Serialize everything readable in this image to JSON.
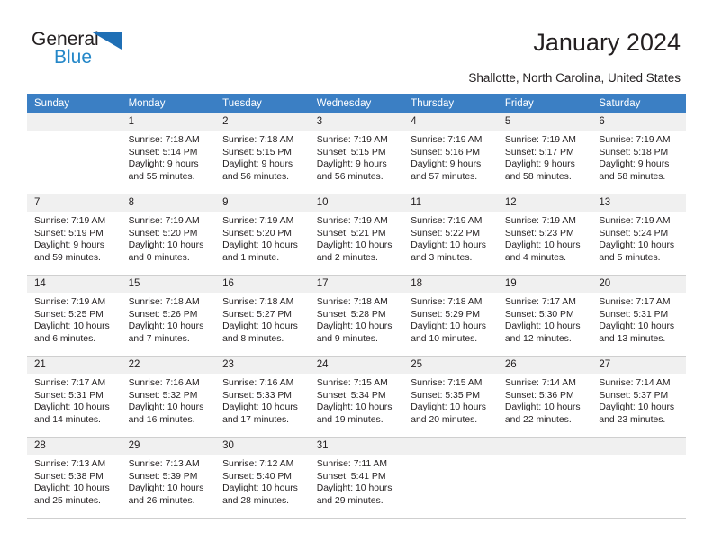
{
  "brand": {
    "name_top": "General",
    "name_bottom": "Blue"
  },
  "header": {
    "title": "January 2024",
    "location": "Shallotte, North Carolina, United States"
  },
  "colors": {
    "header_blue": "#3b7fc4",
    "logo_blue": "#2487c8",
    "daynum_band": "#f0f0f0",
    "grid_line": "#cfcfcf",
    "text": "#231f20"
  },
  "weekdays": [
    "Sunday",
    "Monday",
    "Tuesday",
    "Wednesday",
    "Thursday",
    "Friday",
    "Saturday"
  ],
  "weeks": [
    [
      {
        "day": "",
        "empty": true,
        "sunrise": "",
        "sunset": "",
        "daylight1": "",
        "daylight2": ""
      },
      {
        "day": "1",
        "sunrise": "Sunrise: 7:18 AM",
        "sunset": "Sunset: 5:14 PM",
        "daylight1": "Daylight: 9 hours",
        "daylight2": "and 55 minutes."
      },
      {
        "day": "2",
        "sunrise": "Sunrise: 7:18 AM",
        "sunset": "Sunset: 5:15 PM",
        "daylight1": "Daylight: 9 hours",
        "daylight2": "and 56 minutes."
      },
      {
        "day": "3",
        "sunrise": "Sunrise: 7:19 AM",
        "sunset": "Sunset: 5:15 PM",
        "daylight1": "Daylight: 9 hours",
        "daylight2": "and 56 minutes."
      },
      {
        "day": "4",
        "sunrise": "Sunrise: 7:19 AM",
        "sunset": "Sunset: 5:16 PM",
        "daylight1": "Daylight: 9 hours",
        "daylight2": "and 57 minutes."
      },
      {
        "day": "5",
        "sunrise": "Sunrise: 7:19 AM",
        "sunset": "Sunset: 5:17 PM",
        "daylight1": "Daylight: 9 hours",
        "daylight2": "and 58 minutes."
      },
      {
        "day": "6",
        "sunrise": "Sunrise: 7:19 AM",
        "sunset": "Sunset: 5:18 PM",
        "daylight1": "Daylight: 9 hours",
        "daylight2": "and 58 minutes."
      }
    ],
    [
      {
        "day": "7",
        "sunrise": "Sunrise: 7:19 AM",
        "sunset": "Sunset: 5:19 PM",
        "daylight1": "Daylight: 9 hours",
        "daylight2": "and 59 minutes."
      },
      {
        "day": "8",
        "sunrise": "Sunrise: 7:19 AM",
        "sunset": "Sunset: 5:20 PM",
        "daylight1": "Daylight: 10 hours",
        "daylight2": "and 0 minutes."
      },
      {
        "day": "9",
        "sunrise": "Sunrise: 7:19 AM",
        "sunset": "Sunset: 5:20 PM",
        "daylight1": "Daylight: 10 hours",
        "daylight2": "and 1 minute."
      },
      {
        "day": "10",
        "sunrise": "Sunrise: 7:19 AM",
        "sunset": "Sunset: 5:21 PM",
        "daylight1": "Daylight: 10 hours",
        "daylight2": "and 2 minutes."
      },
      {
        "day": "11",
        "sunrise": "Sunrise: 7:19 AM",
        "sunset": "Sunset: 5:22 PM",
        "daylight1": "Daylight: 10 hours",
        "daylight2": "and 3 minutes."
      },
      {
        "day": "12",
        "sunrise": "Sunrise: 7:19 AM",
        "sunset": "Sunset: 5:23 PM",
        "daylight1": "Daylight: 10 hours",
        "daylight2": "and 4 minutes."
      },
      {
        "day": "13",
        "sunrise": "Sunrise: 7:19 AM",
        "sunset": "Sunset: 5:24 PM",
        "daylight1": "Daylight: 10 hours",
        "daylight2": "and 5 minutes."
      }
    ],
    [
      {
        "day": "14",
        "sunrise": "Sunrise: 7:19 AM",
        "sunset": "Sunset: 5:25 PM",
        "daylight1": "Daylight: 10 hours",
        "daylight2": "and 6 minutes."
      },
      {
        "day": "15",
        "sunrise": "Sunrise: 7:18 AM",
        "sunset": "Sunset: 5:26 PM",
        "daylight1": "Daylight: 10 hours",
        "daylight2": "and 7 minutes."
      },
      {
        "day": "16",
        "sunrise": "Sunrise: 7:18 AM",
        "sunset": "Sunset: 5:27 PM",
        "daylight1": "Daylight: 10 hours",
        "daylight2": "and 8 minutes."
      },
      {
        "day": "17",
        "sunrise": "Sunrise: 7:18 AM",
        "sunset": "Sunset: 5:28 PM",
        "daylight1": "Daylight: 10 hours",
        "daylight2": "and 9 minutes."
      },
      {
        "day": "18",
        "sunrise": "Sunrise: 7:18 AM",
        "sunset": "Sunset: 5:29 PM",
        "daylight1": "Daylight: 10 hours",
        "daylight2": "and 10 minutes."
      },
      {
        "day": "19",
        "sunrise": "Sunrise: 7:17 AM",
        "sunset": "Sunset: 5:30 PM",
        "daylight1": "Daylight: 10 hours",
        "daylight2": "and 12 minutes."
      },
      {
        "day": "20",
        "sunrise": "Sunrise: 7:17 AM",
        "sunset": "Sunset: 5:31 PM",
        "daylight1": "Daylight: 10 hours",
        "daylight2": "and 13 minutes."
      }
    ],
    [
      {
        "day": "21",
        "sunrise": "Sunrise: 7:17 AM",
        "sunset": "Sunset: 5:31 PM",
        "daylight1": "Daylight: 10 hours",
        "daylight2": "and 14 minutes."
      },
      {
        "day": "22",
        "sunrise": "Sunrise: 7:16 AM",
        "sunset": "Sunset: 5:32 PM",
        "daylight1": "Daylight: 10 hours",
        "daylight2": "and 16 minutes."
      },
      {
        "day": "23",
        "sunrise": "Sunrise: 7:16 AM",
        "sunset": "Sunset: 5:33 PM",
        "daylight1": "Daylight: 10 hours",
        "daylight2": "and 17 minutes."
      },
      {
        "day": "24",
        "sunrise": "Sunrise: 7:15 AM",
        "sunset": "Sunset: 5:34 PM",
        "daylight1": "Daylight: 10 hours",
        "daylight2": "and 19 minutes."
      },
      {
        "day": "25",
        "sunrise": "Sunrise: 7:15 AM",
        "sunset": "Sunset: 5:35 PM",
        "daylight1": "Daylight: 10 hours",
        "daylight2": "and 20 minutes."
      },
      {
        "day": "26",
        "sunrise": "Sunrise: 7:14 AM",
        "sunset": "Sunset: 5:36 PM",
        "daylight1": "Daylight: 10 hours",
        "daylight2": "and 22 minutes."
      },
      {
        "day": "27",
        "sunrise": "Sunrise: 7:14 AM",
        "sunset": "Sunset: 5:37 PM",
        "daylight1": "Daylight: 10 hours",
        "daylight2": "and 23 minutes."
      }
    ],
    [
      {
        "day": "28",
        "sunrise": "Sunrise: 7:13 AM",
        "sunset": "Sunset: 5:38 PM",
        "daylight1": "Daylight: 10 hours",
        "daylight2": "and 25 minutes."
      },
      {
        "day": "29",
        "sunrise": "Sunrise: 7:13 AM",
        "sunset": "Sunset: 5:39 PM",
        "daylight1": "Daylight: 10 hours",
        "daylight2": "and 26 minutes."
      },
      {
        "day": "30",
        "sunrise": "Sunrise: 7:12 AM",
        "sunset": "Sunset: 5:40 PM",
        "daylight1": "Daylight: 10 hours",
        "daylight2": "and 28 minutes."
      },
      {
        "day": "31",
        "sunrise": "Sunrise: 7:11 AM",
        "sunset": "Sunset: 5:41 PM",
        "daylight1": "Daylight: 10 hours",
        "daylight2": "and 29 minutes."
      },
      {
        "day": "",
        "empty": true,
        "sunrise": "",
        "sunset": "",
        "daylight1": "",
        "daylight2": ""
      },
      {
        "day": "",
        "empty": true,
        "sunrise": "",
        "sunset": "",
        "daylight1": "",
        "daylight2": ""
      },
      {
        "day": "",
        "empty": true,
        "sunrise": "",
        "sunset": "",
        "daylight1": "",
        "daylight2": ""
      }
    ]
  ]
}
